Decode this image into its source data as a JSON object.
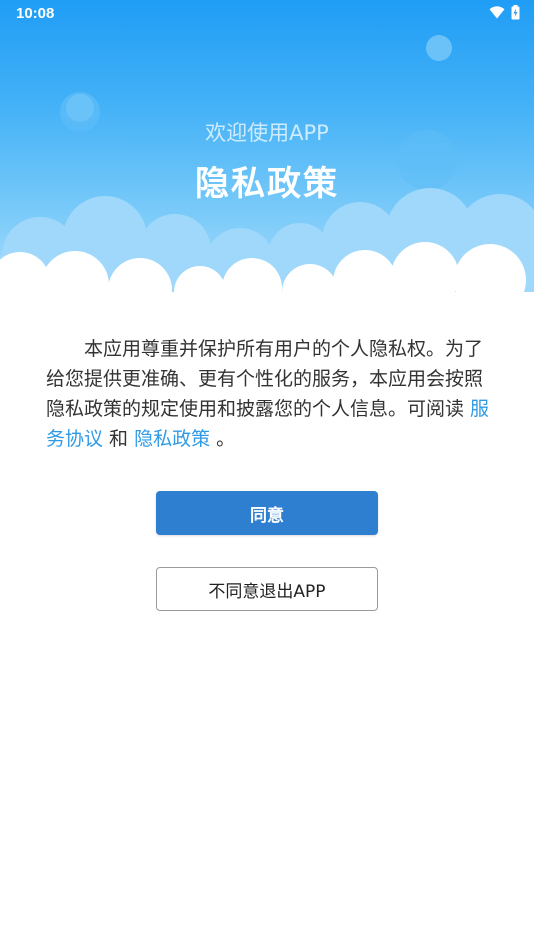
{
  "status_bar": {
    "time": "10:08",
    "icons": [
      "wifi-icon",
      "battery-charging-icon"
    ]
  },
  "header": {
    "welcome": "欢迎使用APP",
    "title": "隐私政策"
  },
  "content": {
    "text_before": "本应用尊重并保护所有用户的个人隐私权。为了给您提供更准确、更有个性化的服务，本应用会按照隐私政策的规定使用和披露您的个人信息。可阅读 ",
    "service_link": "服务协议",
    "and_text": " 和 ",
    "privacy_link": "隐私政策",
    "text_after": " 。"
  },
  "buttons": {
    "agree_label": "同意",
    "exit_label": "不同意退出APP"
  },
  "colors": {
    "accent": "#2f7fd1",
    "link": "#2f9be6",
    "hero_top": "#1f9df5"
  }
}
